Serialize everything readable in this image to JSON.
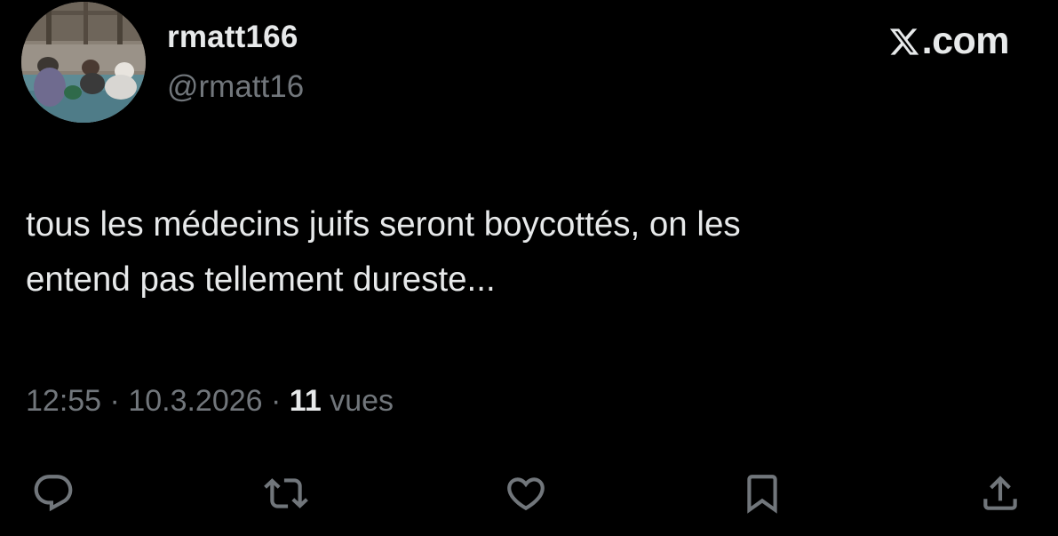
{
  "tweet": {
    "author": {
      "display_name": "rmatt166",
      "handle": "@rmatt16"
    },
    "text_lines": [
      "tous les médecins juifs seront boycottés, on les",
      "entend pas tellement dureste..."
    ],
    "meta": {
      "time": "12:55",
      "sep1": " · ",
      "date": "10.3.2026",
      "sep2": " · ",
      "views_count": "11",
      "views_label": " vues"
    }
  },
  "brand": {
    "domain": ".com",
    "logo_icon": "x-logo-icon"
  },
  "actions": {
    "icons": [
      "reply-icon",
      "retweet-icon",
      "like-icon",
      "bookmark-icon",
      "share-icon"
    ]
  },
  "colors": {
    "background": "#000000",
    "primary_text": "#e7e9ea",
    "secondary_text": "#71767b"
  }
}
